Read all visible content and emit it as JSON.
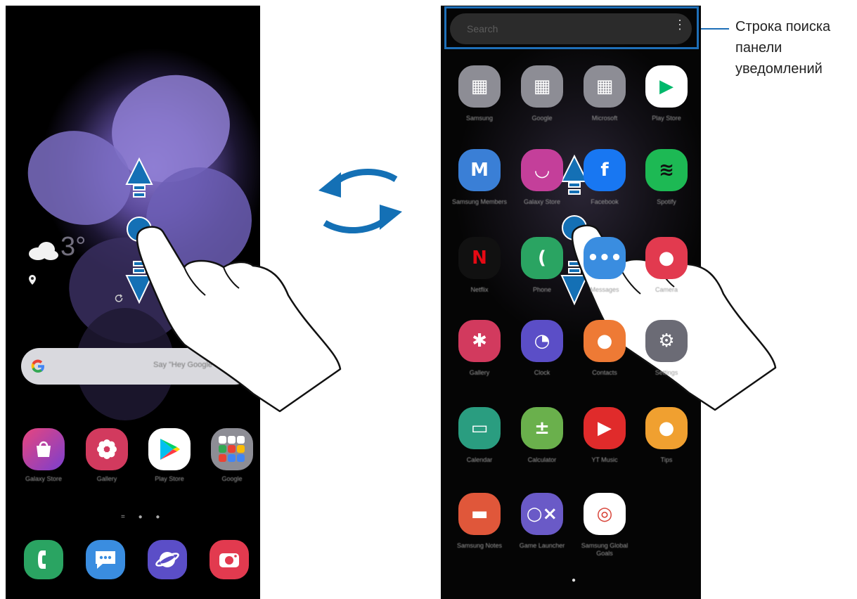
{
  "callout": {
    "lines": [
      "Строка поиска",
      "панели",
      "уведомлений"
    ]
  },
  "left_phone": {
    "weather": {
      "temperature": "3°",
      "cloud_icon": "cloud-icon",
      "location_icon": "location-pin-icon",
      "refresh_icon": "refresh-icon"
    },
    "google_search": {
      "hint": "Say \"Hey Google\""
    },
    "apps": [
      {
        "label": "Galaxy Store",
        "icon": "galaxy-store-icon"
      },
      {
        "label": "Gallery",
        "icon": "gallery-icon"
      },
      {
        "label": "Play Store",
        "icon": "play-store-icon"
      },
      {
        "label": "Google",
        "icon": "google-folder-icon"
      }
    ],
    "dock": [
      {
        "icon": "phone-icon"
      },
      {
        "icon": "messages-icon"
      },
      {
        "icon": "internet-icon"
      },
      {
        "icon": "camera-icon"
      }
    ],
    "page_indicator": "= ● ●"
  },
  "right_phone": {
    "search": {
      "placeholder": "Search"
    },
    "apps": [
      {
        "label": "Samsung",
        "icon": "samsung-folder-icon"
      },
      {
        "label": "Google",
        "icon": "google-folder-icon"
      },
      {
        "label": "Microsoft",
        "icon": "microsoft-folder-icon"
      },
      {
        "label": "Play Store",
        "icon": "play-store-icon"
      },
      {
        "label": "Samsung Members",
        "icon": "samsung-members-icon"
      },
      {
        "label": "Galaxy Store",
        "icon": "galaxy-store-icon"
      },
      {
        "label": "Facebook",
        "icon": "facebook-icon"
      },
      {
        "label": "Spotify",
        "icon": "spotify-icon"
      },
      {
        "label": "Netflix",
        "icon": "netflix-icon"
      },
      {
        "label": "Phone",
        "icon": "phone-icon"
      },
      {
        "label": "Messages",
        "icon": "messages-icon"
      },
      {
        "label": "Camera",
        "icon": "camera-icon"
      },
      {
        "label": "Gallery",
        "icon": "gallery-icon"
      },
      {
        "label": "Clock",
        "icon": "clock-icon"
      },
      {
        "label": "Contacts",
        "icon": "contacts-icon"
      },
      {
        "label": "Settings",
        "icon": "settings-icon"
      },
      {
        "label": "Calendar",
        "icon": "calendar-icon"
      },
      {
        "label": "Calculator",
        "icon": "calculator-icon"
      },
      {
        "label": "YT Music",
        "icon": "yt-music-icon"
      },
      {
        "label": "Tips",
        "icon": "tips-icon"
      },
      {
        "label": "Samsung Notes",
        "icon": "samsung-notes-icon"
      },
      {
        "label": "Game Launcher",
        "icon": "game-launcher-icon"
      },
      {
        "label": "Samsung Global Goals",
        "icon": "global-goals-icon"
      }
    ],
    "page_indicator": "●"
  },
  "colors": {
    "accent_blue": "#1e6fb8",
    "arrow_blue": "#1470b5"
  }
}
